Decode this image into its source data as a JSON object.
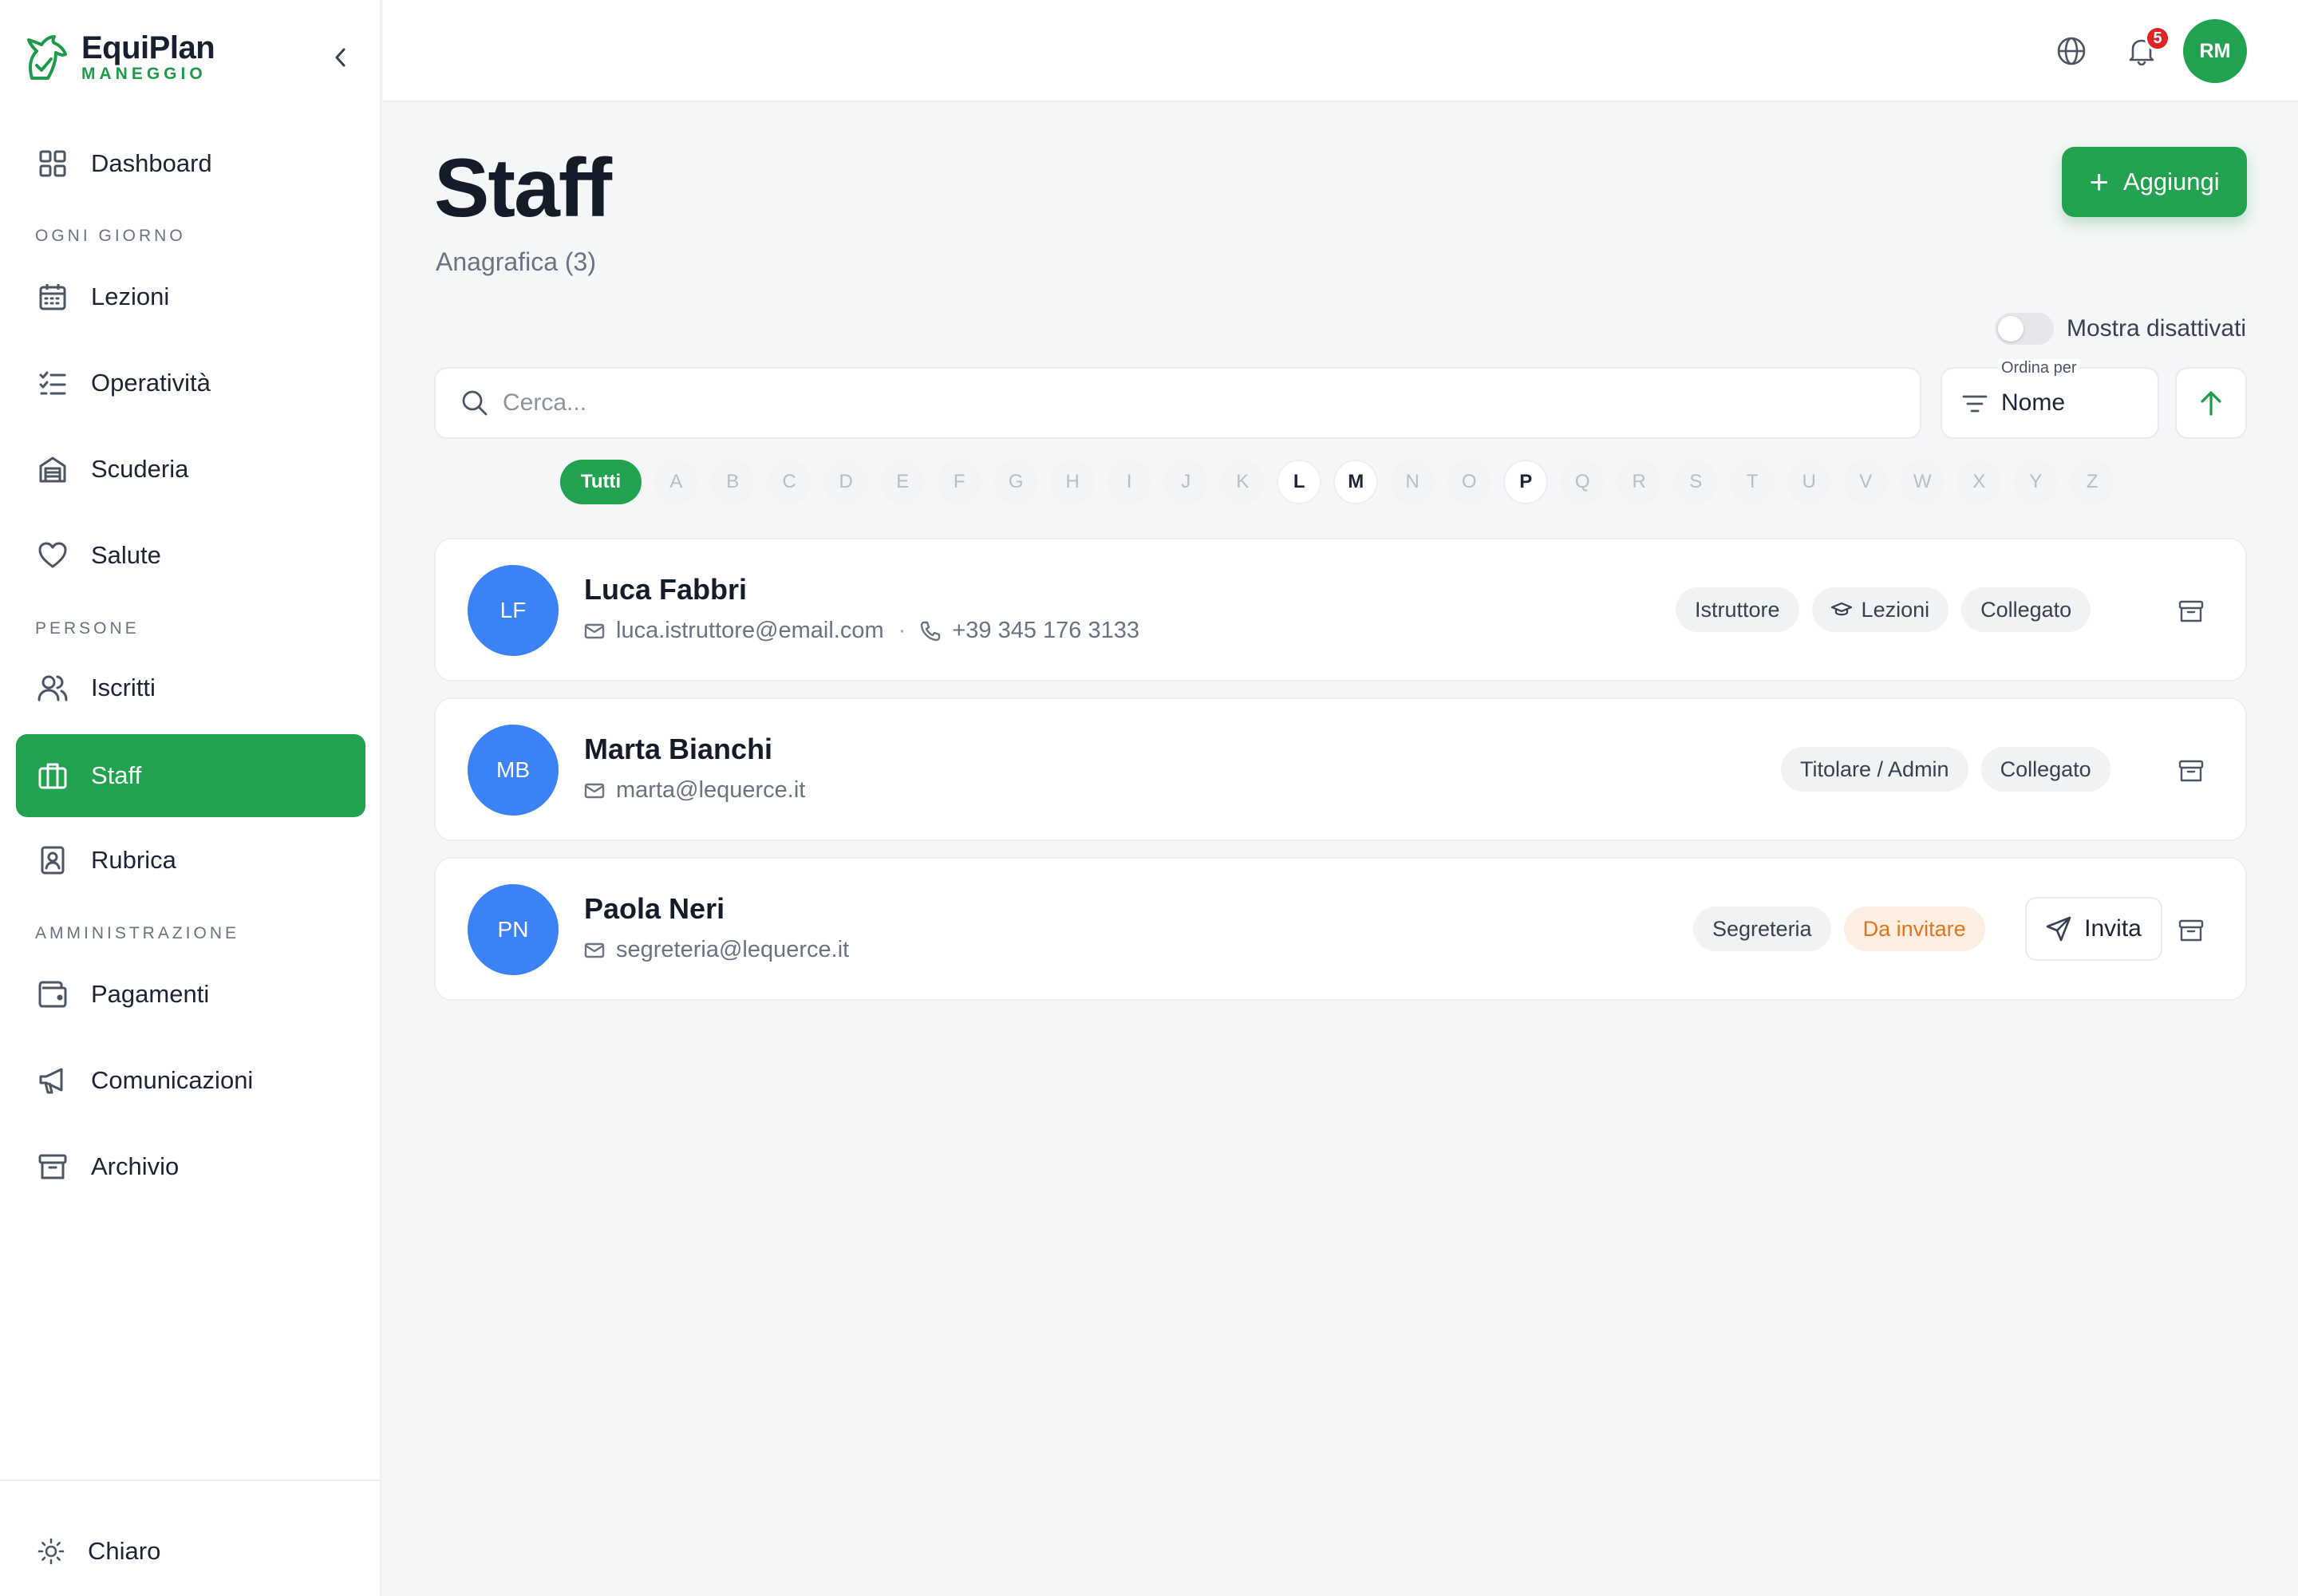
{
  "brand": {
    "name": "EquiPlan",
    "subtitle": "MANEGGIO"
  },
  "sidebar": {
    "dashboard": {
      "label": "Dashboard",
      "icon": "grid-icon"
    },
    "section_daily": "OGNI GIORNO",
    "lezioni": {
      "label": "Lezioni",
      "icon": "calendar-icon"
    },
    "operativita": {
      "label": "Operatività",
      "icon": "checklist-icon"
    },
    "scuderia": {
      "label": "Scuderia",
      "icon": "stable-icon"
    },
    "salute": {
      "label": "Salute",
      "icon": "heart-icon"
    },
    "section_people": "PERSONE",
    "iscritti": {
      "label": "Iscritti",
      "icon": "users-icon"
    },
    "staff": {
      "label": "Staff",
      "icon": "briefcase-icon",
      "active": true
    },
    "rubrica": {
      "label": "Rubrica",
      "icon": "contact-book-icon"
    },
    "section_admin": "AMMINISTRAZIONE",
    "pagamenti": {
      "label": "Pagamenti",
      "icon": "wallet-icon"
    },
    "comunicazioni": {
      "label": "Comunicazioni",
      "icon": "megaphone-icon"
    },
    "archivio": {
      "label": "Archivio",
      "icon": "archive-icon"
    },
    "theme": {
      "label": "Chiaro",
      "icon": "sun-icon"
    }
  },
  "topbar": {
    "notifications_count": "5",
    "user_initials": "RM"
  },
  "page": {
    "title": "Staff",
    "subtitle": "Anagrafica (3)",
    "add_label": "Aggiungi",
    "show_disabled_label": "Mostra disattivati",
    "search_placeholder": "Cerca...",
    "sort_caption": "Ordina per",
    "sort_value": "Nome"
  },
  "alphabet": {
    "all_label": "Tutti",
    "letters": [
      "A",
      "B",
      "C",
      "D",
      "E",
      "F",
      "G",
      "H",
      "I",
      "J",
      "K",
      "L",
      "M",
      "N",
      "O",
      "P",
      "Q",
      "R",
      "S",
      "T",
      "U",
      "V",
      "W",
      "X",
      "Y",
      "Z"
    ],
    "enabled": [
      "L",
      "M",
      "P"
    ]
  },
  "colors": {
    "accent": "#22a24f",
    "avatar": "#3b82f6",
    "badge": "#e02424",
    "warning_text": "#e2741c"
  },
  "staff": [
    {
      "initials": "LF",
      "name": "Luca Fabbri",
      "email": "luca.istruttore@email.com",
      "phone": "+39 345 176 3133",
      "tags": [
        "Istruttore",
        "Lezioni",
        "Collegato"
      ]
    },
    {
      "initials": "MB",
      "name": "Marta Bianchi",
      "email": "marta@lequerce.it",
      "tags": [
        "Titolare / Admin",
        "Collegato"
      ]
    },
    {
      "initials": "PN",
      "name": "Paola Neri",
      "email": "segreteria@lequerce.it",
      "tags": [
        "Segreteria",
        "Da invitare"
      ],
      "invite_label": "Invita"
    }
  ]
}
